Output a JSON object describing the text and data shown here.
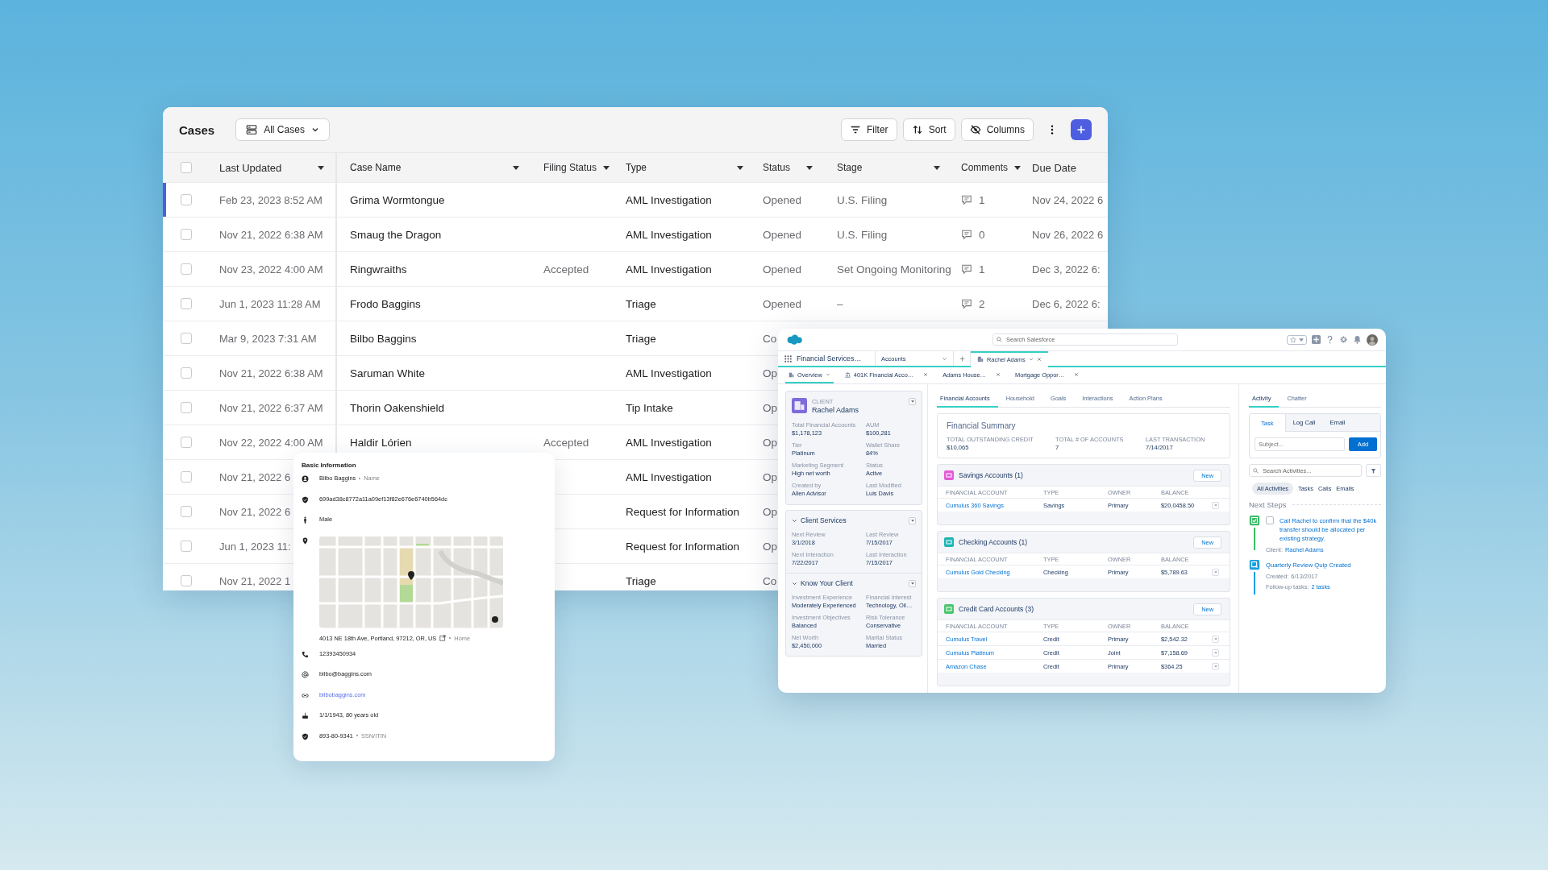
{
  "cases": {
    "title": "Cases",
    "view": "All Cases",
    "actions": [
      {
        "kind": "filter",
        "label": "Filter"
      },
      {
        "kind": "sort",
        "label": "Sort"
      },
      {
        "kind": "columns",
        "label": "Columns"
      }
    ],
    "select_all": {
      "checked": false
    },
    "columns": [
      {
        "label": "Last Updated",
        "sortable": true
      },
      {
        "label": "Case Name",
        "sortable": true
      },
      {
        "label": "Filing Status",
        "sortable": true
      },
      {
        "label": "Type",
        "sortable": true
      },
      {
        "label": "Status",
        "sortable": true
      },
      {
        "label": "Stage",
        "sortable": true
      },
      {
        "label": "Comments",
        "sortable": true
      },
      {
        "label": "Due Date",
        "sortable": false
      }
    ],
    "rows": [
      {
        "selected": true,
        "checked": false,
        "updated": "Feb 23, 2023 8:52 AM",
        "name": "Grima Wormtongue",
        "type": "AML Investigation",
        "status": "Opened",
        "stage": "U.S. Filing",
        "comments": "1",
        "due": "Nov 24, 2022 6"
      },
      {
        "selected": false,
        "checked": false,
        "updated": "Nov 21, 2022 6:38 AM",
        "name": "Smaug the Dragon",
        "type": "AML Investigation",
        "status": "Opened",
        "stage": "U.S. Filing",
        "comments": "0",
        "due": "Nov 26, 2022 6"
      },
      {
        "selected": false,
        "checked": false,
        "updated": "Nov 23, 2022 4:00 AM",
        "name": "Ringwraiths",
        "filing": "Accepted",
        "type": "AML Investigation",
        "status": "Opened",
        "stage": "Set Ongoing Monitoring",
        "comments": "1",
        "due": "Dec 3, 2022 6:"
      },
      {
        "selected": false,
        "checked": false,
        "updated": "Jun 1, 2023 11:28 AM",
        "name": "Frodo Baggins",
        "type": "Triage",
        "status": "Opened",
        "stage": "–",
        "comments": "2",
        "due": "Dec 6, 2022 6:"
      },
      {
        "selected": false,
        "checked": false,
        "updated": "Mar 9, 2023 7:31 AM",
        "name": "Bilbo Baggins",
        "type": "Triage",
        "status": "Co"
      },
      {
        "selected": false,
        "checked": false,
        "updated": "Nov 21, 2022 6:38 AM",
        "name": "Saruman White",
        "type": "AML Investigation",
        "status": "Op"
      },
      {
        "selected": false,
        "checked": false,
        "updated": "Nov 21, 2022 6:37 AM",
        "name": "Thorin Oakenshield",
        "type": "Tip Intake",
        "status": "Op"
      },
      {
        "selected": false,
        "checked": false,
        "updated": "Nov 22, 2022 4:00 AM",
        "name": "Haldir Lórien",
        "filing": "Accepted",
        "type": "AML Investigation",
        "status": "Op"
      },
      {
        "selected": false,
        "checked": false,
        "updated": "Nov 21, 2022 6",
        "type": "AML Investigation",
        "status": "Op"
      },
      {
        "selected": false,
        "checked": false,
        "updated": "Nov 21, 2022 6",
        "type": "Request for Information",
        "status": "Op"
      },
      {
        "selected": false,
        "checked": false,
        "updated": "Jun 1, 2023 11:",
        "type": "Request for Information",
        "status": "Op"
      },
      {
        "selected": false,
        "checked": false,
        "updated": "Nov 21, 2022 1",
        "type": "Triage",
        "status": "Co"
      }
    ]
  },
  "basic_info": {
    "title": "Basic Information",
    "fields": [
      {
        "kind": "name",
        "value": "Bilbo Baggins",
        "tag": "Name"
      },
      {
        "kind": "id",
        "value": "699ad38c8772a11a09ef13f82e676e6740b564dc"
      },
      {
        "kind": "gender",
        "value": "Male"
      },
      {
        "kind": "address",
        "value": "4013 NE 18th Ave, Portland, 97212, OR, US",
        "external_link": true,
        "tag": "Home"
      },
      {
        "kind": "phone",
        "value": "12393450934"
      },
      {
        "kind": "email",
        "value": "bilbo@baggins.com"
      },
      {
        "kind": "website",
        "value": "bilbobaggins.com"
      },
      {
        "kind": "birthday",
        "value": "1/1/1943, 80 years old"
      },
      {
        "kind": "ssn",
        "value": "893-80-9341",
        "tag": "SSN/ITIN"
      }
    ]
  },
  "crm": {
    "search": {
      "placeholder": "Search Salesforce"
    },
    "app_name": "Financial Services…",
    "nav": [
      {
        "kind": "dropdown",
        "label": "Accounts",
        "selected": false
      },
      {
        "kind": "record",
        "label": "Rachel Adams",
        "selected": true
      }
    ],
    "subtabs": [
      {
        "label": "Overview",
        "selected": true,
        "closable": false
      },
      {
        "label": "401K Financial Acco…",
        "selected": false,
        "closable": true
      },
      {
        "label": "Adams House…",
        "selected": false,
        "closable": true
      },
      {
        "label": "Mortgage Oppor…",
        "selected": false,
        "closable": true
      }
    ],
    "client": {
      "caption": "CLIENT",
      "name": "Rachel Adams",
      "fields": [
        {
          "label": "Total Financial Accounts",
          "value": "$1,178,123"
        },
        {
          "label": "AUM",
          "value": "$100,281"
        },
        {
          "label": "Tier",
          "value": "Platinum"
        },
        {
          "label": "Wallet Share",
          "value": "84%"
        },
        {
          "label": "Marketing Segment",
          "value": "High net worth"
        },
        {
          "label": "Status",
          "value": "Active"
        },
        {
          "label": "Created by",
          "value": "Allen Advisor"
        },
        {
          "label": "Last Modified",
          "value": "Luis Davis"
        }
      ]
    },
    "sections": [
      {
        "title": "Client Services",
        "expanded": true,
        "fields": [
          {
            "label": "Next Review",
            "value": "3/1/2018"
          },
          {
            "label": "Last Review",
            "value": "7/15/2017"
          },
          {
            "label": "Next Interaction",
            "value": "7/22/2017"
          },
          {
            "label": "Last Interaction",
            "value": "7/15/2017"
          }
        ]
      },
      {
        "title": "Know Your Client",
        "expanded": true,
        "fields": [
          {
            "label": "Investment Experience",
            "value": "Moderately Experienced"
          },
          {
            "label": "Financial Interest",
            "value": "Technology, Oil…"
          },
          {
            "label": "Investment Objectives",
            "value": "Balanced"
          },
          {
            "label": "Risk Tolerance",
            "value": "Conservative"
          },
          {
            "label": "Net Worth",
            "value": "$2,450,000"
          },
          {
            "label": "Marital Status",
            "value": "Married"
          }
        ]
      }
    ],
    "tabs": [
      {
        "label": "Financial Accounts",
        "selected": true
      },
      {
        "label": "Household",
        "selected": false
      },
      {
        "label": "Goals",
        "selected": false
      },
      {
        "label": "Interactions",
        "selected": false
      },
      {
        "label": "Action Plans",
        "selected": false
      }
    ],
    "summary": {
      "title": "Financial Summary",
      "stats": [
        {
          "label": "TOTAL OUTSTANDING CREDIT",
          "value": "$10,065"
        },
        {
          "label": "TOTAL # OF ACCOUNTS",
          "value": "7"
        },
        {
          "label": "LAST TRANSACTION",
          "value": "7/14/2017"
        }
      ]
    },
    "account_groups": [
      {
        "title": "Savings Accounts (1)",
        "color": "#e25cd6",
        "button": "New",
        "columns": [
          "FINANCIAL ACCOUNT",
          "TYPE",
          "OWNER",
          "BALANCE"
        ],
        "rows": [
          {
            "account": "Cumulus 360 Savings",
            "type": "Savings",
            "owner": "Primary",
            "balance": "$20,0458.50"
          }
        ]
      },
      {
        "title": "Checking Accounts (1)",
        "color": "#1fb5b5",
        "button": "New",
        "columns": [
          "FINANCIAL ACCOUNT",
          "TYPE",
          "OWNER",
          "BALANCE"
        ],
        "rows": [
          {
            "account": "Cumulus Gold Checking",
            "type": "Checking",
            "owner": "Primary",
            "balance": "$5,789.63"
          }
        ]
      },
      {
        "title": "Credit Card Accounts (3)",
        "color": "#4bc66f",
        "button": "New",
        "columns": [
          "FINANCIAL ACCOUNT",
          "TYPE",
          "OWNER",
          "BALANCE"
        ],
        "rows": [
          {
            "account": "Cumulus Travel",
            "type": "Credit",
            "owner": "Primary",
            "balance": "$2,542.32"
          },
          {
            "account": "Cumulus Platinum",
            "type": "Credit",
            "owner": "Joint",
            "balance": "$7,158.69"
          },
          {
            "account": "Amazon Chase",
            "type": "Credit",
            "owner": "Primary",
            "balance": "$364.25"
          }
        ]
      }
    ],
    "activity": {
      "tabs": [
        {
          "label": "Activity",
          "selected": true
        },
        {
          "label": "Chatter",
          "selected": false
        }
      ],
      "composer_tabs": [
        {
          "label": "Task",
          "selected": true
        },
        {
          "label": "Log Call",
          "selected": false
        },
        {
          "label": "Email",
          "selected": false
        }
      ],
      "subject": {
        "placeholder": "Subject..."
      },
      "add_button": "Add",
      "search": {
        "placeholder": "Search Activities..."
      },
      "filters": [
        {
          "label": "All Activities",
          "selected": true
        },
        {
          "label": "Tasks",
          "selected": false
        },
        {
          "label": "Calls",
          "selected": false
        },
        {
          "label": "Emails",
          "selected": false
        }
      ],
      "next_steps": "Next Steps",
      "items": [
        {
          "kind": "task",
          "color": "#3dbb6a",
          "checked": false,
          "title": "Call Rachel to confirm that the $40k transfer should be allocated per existing strategy.",
          "details": [
            {
              "label": "Client:",
              "value": "Rachel Adams",
              "link": true
            }
          ]
        },
        {
          "kind": "quip",
          "color": "#1a9ee0",
          "title": "Quarterly Review Quip Created",
          "details": [
            {
              "label": "Created:",
              "value": "6/13/2017",
              "link": false
            },
            {
              "label": "Follow-up tasks:",
              "value": "2 tasks",
              "link": true
            }
          ]
        }
      ]
    }
  }
}
